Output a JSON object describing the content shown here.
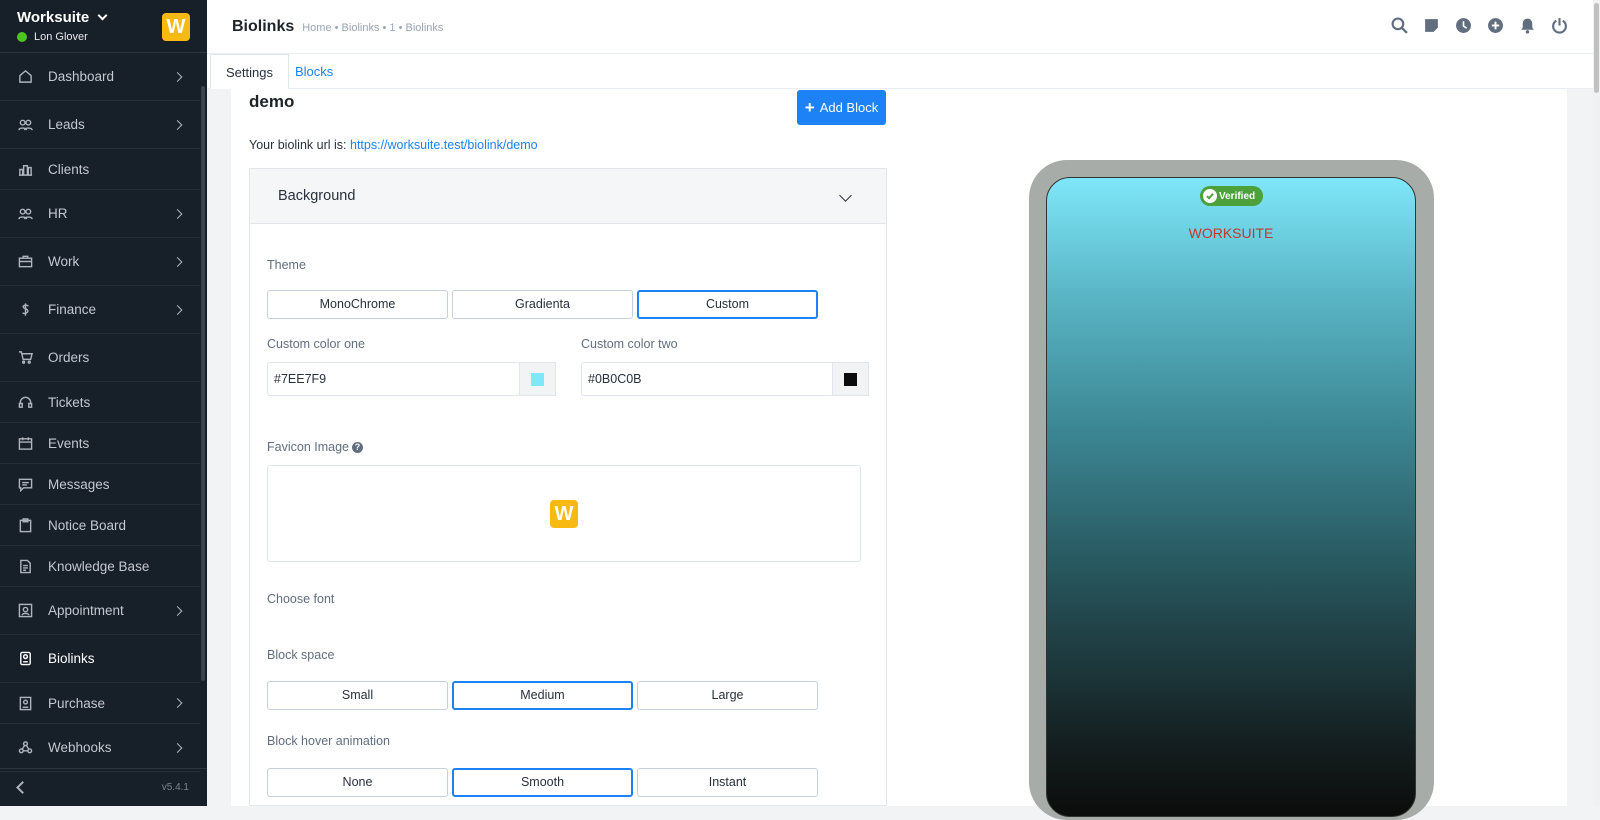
{
  "sidebar": {
    "company": "Worksuite",
    "user": "Lon Glover",
    "logo_letter": "W",
    "version": "v5.4.1",
    "items": [
      {
        "label": "Dashboard",
        "icon": "house-icon",
        "arrow": true
      },
      {
        "label": "Leads",
        "icon": "users-icon",
        "arrow": true
      },
      {
        "label": "Clients",
        "icon": "building-icon",
        "arrow": false
      },
      {
        "label": "HR",
        "icon": "people-icon",
        "arrow": true
      },
      {
        "label": "Work",
        "icon": "briefcase-icon",
        "arrow": true
      },
      {
        "label": "Finance",
        "icon": "dollar-icon",
        "arrow": true
      },
      {
        "label": "Orders",
        "icon": "cart-icon",
        "arrow": false
      },
      {
        "label": "Tickets",
        "icon": "headset-icon",
        "arrow": false
      },
      {
        "label": "Events",
        "icon": "calendar-icon",
        "arrow": false
      },
      {
        "label": "Messages",
        "icon": "chat-icon",
        "arrow": false
      },
      {
        "label": "Notice Board",
        "icon": "clipboard-icon",
        "arrow": false
      },
      {
        "label": "Knowledge Base",
        "icon": "document-icon",
        "arrow": false
      },
      {
        "label": "Appointment",
        "icon": "appointment-icon",
        "arrow": true
      },
      {
        "label": "Biolinks",
        "icon": "biolink-icon",
        "arrow": false,
        "active": true
      },
      {
        "label": "Purchase",
        "icon": "purchase-icon",
        "arrow": true
      },
      {
        "label": "Webhooks",
        "icon": "webhook-icon",
        "arrow": true
      }
    ]
  },
  "header": {
    "title": "Biolinks",
    "breadcrumb": "Home • Biolinks • 1 • Biolinks",
    "icons": [
      "search-icon",
      "sticky-note-icon",
      "clock-icon",
      "plus-circle-icon",
      "bell-icon",
      "power-icon"
    ]
  },
  "tabs": {
    "settings": "Settings",
    "blocks": "Blocks"
  },
  "main": {
    "page_name": "demo",
    "add_block": "Add Block",
    "url_prefix": "Your biolink url is:",
    "url": "https://worksuite.test/biolink/demo",
    "accordion_title": "Background",
    "theme_label": "Theme",
    "themes": [
      "MonoChrome",
      "Gradienta",
      "Custom"
    ],
    "selected_theme": "Custom",
    "color_one_label": "Custom color one",
    "color_one_value": "#7EE7F9",
    "color_two_label": "Custom color two",
    "color_two_value": "#0B0C0B",
    "favicon_label": "Favicon Image",
    "font_label": "Choose font",
    "block_space_label": "Block space",
    "block_spaces": [
      "Small",
      "Medium",
      "Large"
    ],
    "selected_block_space": "Medium",
    "hover_label": "Block hover animation",
    "hover_options": [
      "None",
      "Smooth",
      "Instant"
    ],
    "selected_hover": "Smooth"
  },
  "preview": {
    "verified": "Verified",
    "name": "WORKSUITE"
  },
  "colors": {
    "accent": "#1d82f5",
    "sidebar_bg": "#171f29",
    "logo": "#f9b913",
    "name_color": "#c0392b"
  }
}
